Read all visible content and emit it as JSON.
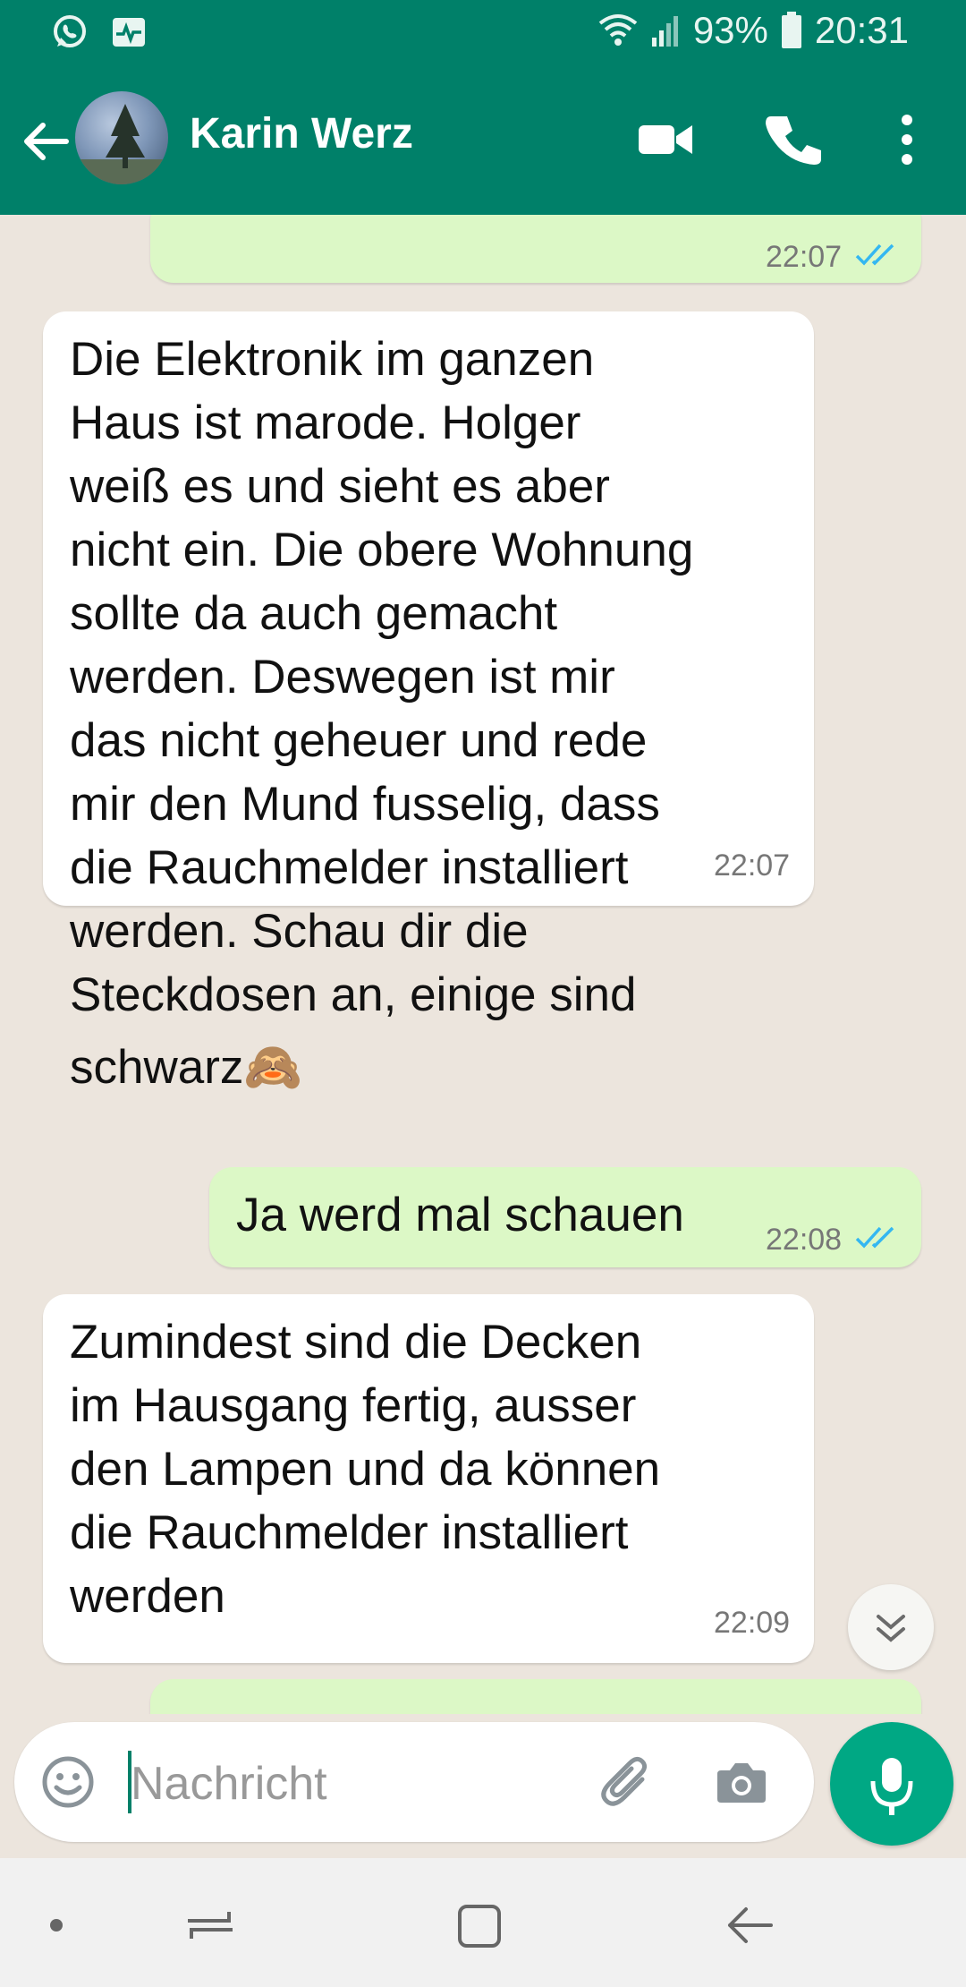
{
  "status_bar": {
    "battery": "93%",
    "time": "20:31",
    "icons": [
      "whatsapp-notification-icon",
      "activity-icon",
      "wifi-icon",
      "signal-icon",
      "battery-icon"
    ]
  },
  "header": {
    "contact_name": "Karin Werz",
    "icons": [
      "back-arrow-icon",
      "video-call-icon",
      "phone-icon",
      "more-vert-icon"
    ]
  },
  "messages": [
    {
      "direction": "outgoing",
      "text": "",
      "time": "22:07",
      "status": "read"
    },
    {
      "direction": "incoming",
      "lines": [
        "Die Elektronik im ganzen",
        "Haus ist marode. Holger",
        "weiß es und sieht es aber",
        "nicht ein. Die obere Wohnung",
        "sollte da auch gemacht",
        "werden. Deswegen ist mir",
        "das nicht geheuer und rede",
        "mir den Mund fusselig, dass",
        "die Rauchmelder installiert",
        "werden. Schau dir die",
        "Steckdosen an, einige sind",
        "schwarz🙈"
      ],
      "time": "22:07"
    },
    {
      "direction": "outgoing",
      "text": "Ja werd mal schauen",
      "time": "22:08",
      "status": "read"
    },
    {
      "direction": "incoming",
      "lines": [
        "Zumindest sind die Decken",
        "im Hausgang fertig, ausser",
        "den Lampen und da können",
        "die Rauchmelder installiert",
        "werden"
      ],
      "time": "22:09"
    }
  ],
  "composer": {
    "placeholder": "Nachricht",
    "icons": [
      "emoji-icon",
      "attach-icon",
      "camera-icon",
      "mic-icon"
    ]
  },
  "colors": {
    "primary": "#008069",
    "accent": "#00a884",
    "outgoing_bubble": "#dcf8c6",
    "incoming_bubble": "#ffffff",
    "tick_read": "#34b7f1"
  }
}
